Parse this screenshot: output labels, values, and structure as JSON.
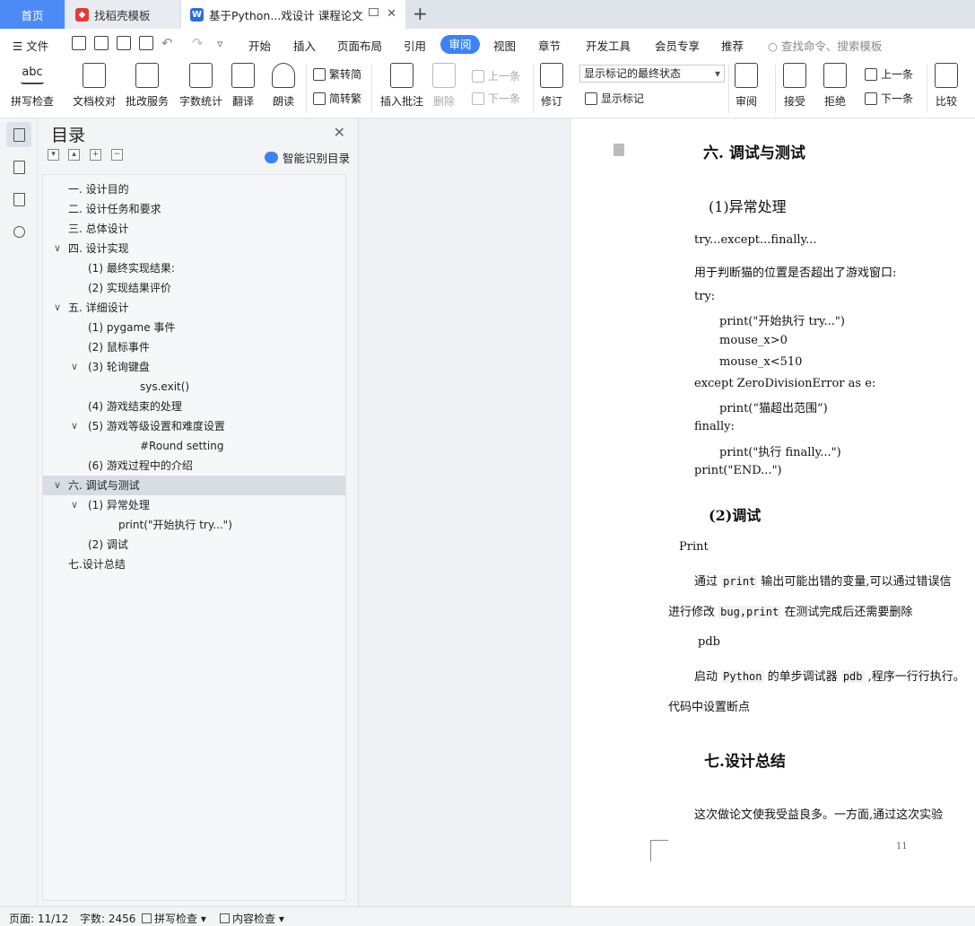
{
  "tabs": {
    "home": "首页",
    "template": "找稻壳模板",
    "document": "基于Python...戏设计 课程论文"
  },
  "menu": {
    "file": "文件",
    "items": [
      "开始",
      "插入",
      "页面布局",
      "引用",
      "审阅",
      "视图",
      "章节",
      "开发工具",
      "会员专享",
      "推荐"
    ],
    "active": "审阅",
    "search": "查找命令、搜索模板"
  },
  "ribbon": {
    "spell": "拼写检查",
    "proofread": "文档校对",
    "review_service": "批改服务",
    "word_count": "字数统计",
    "translate": "翻译",
    "read_aloud": "朗读",
    "trad_to_simp": "繁转简",
    "simp_to_trad": "简转繁",
    "insert_comment": "插入批注",
    "delete": "删除",
    "prev_comment": "上一条",
    "next_comment": "下一条",
    "track_changes": "修订",
    "markup_state": "显示标记的最终状态",
    "show_markup": "显示标记",
    "review": "审阅",
    "accept": "接受",
    "reject": "拒绝",
    "prev_change": "上一条",
    "next_change": "下一条",
    "compare": "比较"
  },
  "toc": {
    "title": "目录",
    "smart": "智能识别目录",
    "items": [
      {
        "label": "一. 设计目的"
      },
      {
        "label": "二. 设计任务和要求"
      },
      {
        "label": "三. 总体设计"
      },
      {
        "label": "四. 设计实现"
      },
      {
        "label": "(1) 最终实现结果:"
      },
      {
        "label": "(2) 实现结果评价"
      },
      {
        "label": "五. 详细设计"
      },
      {
        "label": "(1) pygame 事件"
      },
      {
        "label": "(2)  鼠标事件"
      },
      {
        "label": "(3) 轮询键盘"
      },
      {
        "label": "sys.exit()"
      },
      {
        "label": "(4) 游戏结束的处理"
      },
      {
        "label": "(5) 游戏等级设置和难度设置"
      },
      {
        "label": "#Round setting"
      },
      {
        "label": "(6) 游戏过程中的介绍"
      },
      {
        "label": "六. 调试与测试"
      },
      {
        "label": "(1) 异常处理"
      },
      {
        "label": "print(\"开始执行 try...\")"
      },
      {
        "label": "(2) 调试"
      },
      {
        "label": "七.设计总结"
      }
    ]
  },
  "document": {
    "h_six": "六. 调试与测试",
    "h_exception": "(1)异常处理",
    "try_line": "try...except...finally...",
    "desc": "用于判断猫的位置是否超出了游戏窗口:",
    "code": [
      "try:",
      "print(\"开始执行 try...\")",
      "mouse_x>0",
      "mouse_x<510",
      "except ZeroDivisionError as e:",
      "print(“猫超出范围”)",
      "finally:",
      "print(\"执行 finally...\")",
      "print(\"END...\")"
    ],
    "h_debug": "(2)调试",
    "print_label": "Print",
    "print_desc_1": "通过",
    "print_desc_code": "print",
    "print_desc_2": "输出可能出错的变量,可以通过错误信",
    "print_desc_3": "进行修改",
    "print_desc_bug": "bug,print",
    "print_desc_4": "在测试完成后还需要删除",
    "pdb_label": "pdb",
    "pdb_desc_1": "启动",
    "pdb_desc_py": "Python",
    "pdb_desc_2": "的单步调试器",
    "pdb_desc_pdb": "pdb",
    "pdb_desc_3": ",程序一行行执行。",
    "pdb_desc_4": "代码中设置断点",
    "h_seven": "七.设计总结",
    "summary": "这次做论文使我受益良多。一方面,通过这次实验",
    "page_number": "11"
  },
  "status": {
    "page": "页面: 11/12",
    "words": "字数: 2456",
    "spell": "拼写检查",
    "content_check": "内容检查"
  },
  "colors": {
    "accent": "#3b82f6",
    "home_tab": "#4c8bf5",
    "toc_selected": "#d8dce3"
  }
}
